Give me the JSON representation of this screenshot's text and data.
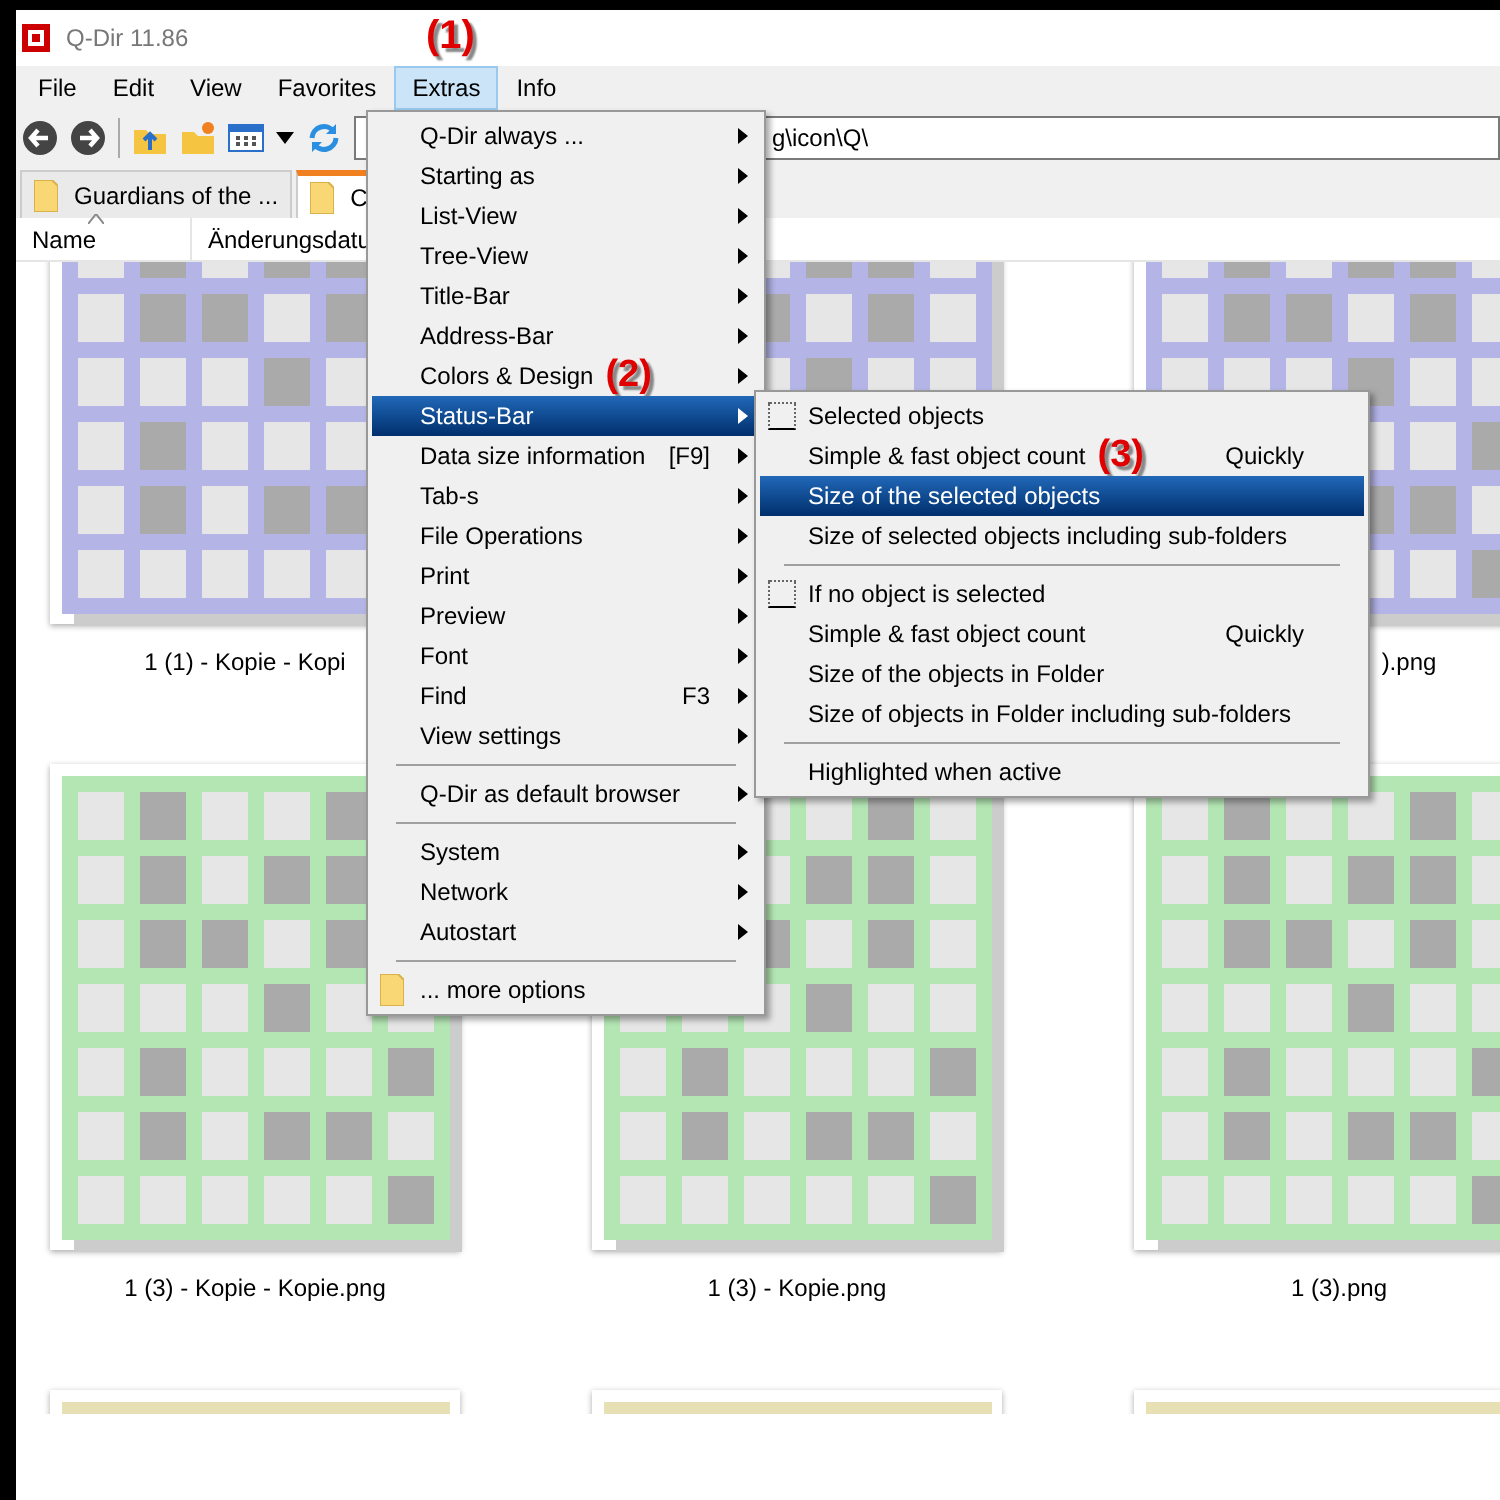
{
  "window": {
    "title": "Q-Dir 11.86",
    "marker": "(1)"
  },
  "menu_bar": [
    {
      "label": "File",
      "selected": false
    },
    {
      "label": "Edit",
      "selected": false
    },
    {
      "label": "View",
      "selected": false
    },
    {
      "label": "Favorites",
      "selected": false
    },
    {
      "label": "Extras",
      "selected": true
    },
    {
      "label": "Info",
      "selected": false
    }
  ],
  "address_bar": {
    "value": "g\\icon\\Q\\"
  },
  "tabs": [
    {
      "label": "Guardians of the ...",
      "selected": false
    },
    {
      "label": "C",
      "selected": true
    }
  ],
  "columns": [
    "Name",
    "Änderungsdatu"
  ],
  "thumbnail_rows": [
    {
      "color": "#b4b4e6",
      "items": [
        {
          "kind": "image",
          "label": "1 (1) - Kopie - Kopi"
        },
        {
          "kind": "image"
        },
        {
          "kind": "image",
          "label": ").png"
        }
      ]
    },
    {
      "color": "#b4e6b4",
      "items": [
        {
          "kind": "image",
          "label": "1 (3) - Kopie - Kopie.png"
        },
        {
          "kind": "image",
          "label": "1 (3) - Kopie.png"
        },
        {
          "kind": "image",
          "label": "1 (3).png"
        }
      ]
    },
    {
      "color": "#e6e0b4",
      "items": [
        {
          "kind": "image"
        },
        {
          "kind": "image"
        },
        {
          "kind": "image"
        }
      ]
    }
  ],
  "menu": [
    {
      "kind": "item",
      "label": "Q-Dir always ...",
      "submenu": true,
      "selected": false
    },
    {
      "kind": "item",
      "label": "Starting as",
      "submenu": true,
      "selected": false
    },
    {
      "kind": "item",
      "label": "List-View",
      "submenu": true,
      "selected": false
    },
    {
      "kind": "item",
      "label": "Tree-View",
      "submenu": true,
      "selected": false
    },
    {
      "kind": "item",
      "label": "Title-Bar",
      "submenu": true,
      "selected": false
    },
    {
      "kind": "item",
      "label": "Address-Bar",
      "submenu": true,
      "selected": false
    },
    {
      "kind": "item",
      "label": "Colors & Design",
      "marker": "(2)",
      "submenu": true,
      "selected": false
    },
    {
      "kind": "item",
      "label": "Status-Bar",
      "submenu": true,
      "selected": true
    },
    {
      "kind": "item",
      "label": "Data size information",
      "shortcut": "[F9]",
      "submenu": true,
      "selected": false
    },
    {
      "kind": "item",
      "label": "Tab-s",
      "submenu": true,
      "selected": false
    },
    {
      "kind": "item",
      "label": "File Operations",
      "submenu": true,
      "selected": false
    },
    {
      "kind": "item",
      "label": "Print",
      "submenu": true,
      "selected": false
    },
    {
      "kind": "item",
      "label": "Preview",
      "submenu": true,
      "selected": false
    },
    {
      "kind": "item",
      "label": "Font",
      "submenu": true,
      "selected": false
    },
    {
      "kind": "item",
      "label": "Find",
      "shortcut": "F3",
      "submenu": true,
      "selected": false
    },
    {
      "kind": "item",
      "label": "View settings",
      "submenu": true,
      "selected": false
    },
    {
      "kind": "separator"
    },
    {
      "kind": "item",
      "label": "Q-Dir as default browser",
      "submenu": true,
      "selected": false
    },
    {
      "kind": "separator"
    },
    {
      "kind": "item",
      "label": "System",
      "submenu": true,
      "selected": false
    },
    {
      "kind": "item",
      "label": "Network",
      "submenu": true,
      "selected": false
    },
    {
      "kind": "item",
      "label": "Autostart",
      "submenu": true,
      "selected": false
    },
    {
      "kind": "separator"
    },
    {
      "kind": "folder",
      "label": "... more options",
      "submenu": false,
      "selected": false
    }
  ],
  "submenu": [
    {
      "kind": "checkbox",
      "label": "Selected objects",
      "checked": false,
      "selected": false
    },
    {
      "kind": "item",
      "label": "Simple & fast object count",
      "marker": "(3)",
      "shortcut": "Quickly",
      "selected": false
    },
    {
      "kind": "item",
      "label": "Size of the selected objects",
      "selected": true
    },
    {
      "kind": "item",
      "label": "Size of selected objects including sub-folders",
      "selected": false
    },
    {
      "kind": "separator"
    },
    {
      "kind": "checkbox",
      "label": "If no object is selected",
      "checked": false,
      "selected": false
    },
    {
      "kind": "item",
      "label": "Simple & fast object count",
      "shortcut": "Quickly",
      "selected": false
    },
    {
      "kind": "item",
      "label": "Size of the objects in Folder",
      "selected": false
    },
    {
      "kind": "item",
      "label": "Size of objects in Folder including sub-folders",
      "selected": false
    },
    {
      "kind": "separator"
    },
    {
      "kind": "item",
      "label": "Highlighted when active",
      "selected": false
    }
  ]
}
